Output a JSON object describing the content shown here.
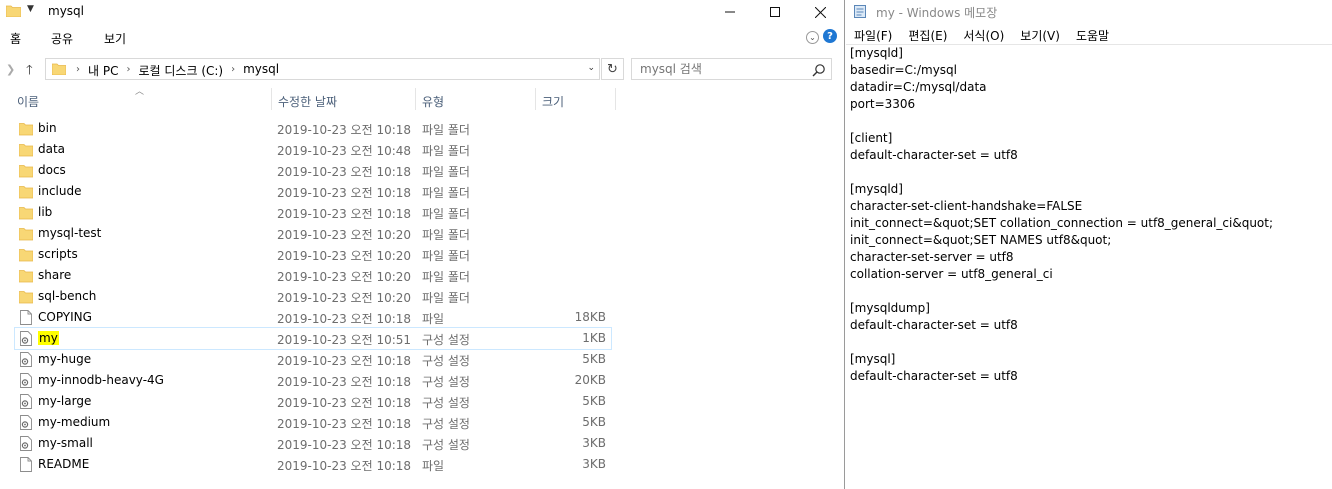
{
  "explorer": {
    "title": "mysql",
    "ribbon_tabs": [
      "홈",
      "공유",
      "보기"
    ],
    "breadcrumb": [
      "내 PC",
      "로컬 디스크 (C:)",
      "mysql"
    ],
    "search_placeholder": "mysql 검색",
    "columns": {
      "name": "이름",
      "date": "수정한 날짜",
      "type": "유형",
      "size": "크기"
    },
    "files": [
      {
        "name": "bin",
        "date": "2019-10-23 오전 10:18",
        "type": "파일 폴더",
        "size": "",
        "icon": "folder-icon"
      },
      {
        "name": "data",
        "date": "2019-10-23 오전 10:48",
        "type": "파일 폴더",
        "size": "",
        "icon": "folder-icon"
      },
      {
        "name": "docs",
        "date": "2019-10-23 오전 10:18",
        "type": "파일 폴더",
        "size": "",
        "icon": "folder-icon"
      },
      {
        "name": "include",
        "date": "2019-10-23 오전 10:18",
        "type": "파일 폴더",
        "size": "",
        "icon": "folder-icon"
      },
      {
        "name": "lib",
        "date": "2019-10-23 오전 10:18",
        "type": "파일 폴더",
        "size": "",
        "icon": "folder-icon"
      },
      {
        "name": "mysql-test",
        "date": "2019-10-23 오전 10:20",
        "type": "파일 폴더",
        "size": "",
        "icon": "folder-icon"
      },
      {
        "name": "scripts",
        "date": "2019-10-23 오전 10:20",
        "type": "파일 폴더",
        "size": "",
        "icon": "folder-icon"
      },
      {
        "name": "share",
        "date": "2019-10-23 오전 10:20",
        "type": "파일 폴더",
        "size": "",
        "icon": "folder-icon"
      },
      {
        "name": "sql-bench",
        "date": "2019-10-23 오전 10:20",
        "type": "파일 폴더",
        "size": "",
        "icon": "folder-icon"
      },
      {
        "name": "COPYING",
        "date": "2019-10-23 오전 10:18",
        "type": "파일",
        "size": "18KB",
        "icon": "file-icon"
      },
      {
        "name": "my",
        "date": "2019-10-23 오전 10:51",
        "type": "구성 설정",
        "size": "1KB",
        "icon": "config-file-icon",
        "selected": true,
        "highlighted": true
      },
      {
        "name": "my-huge",
        "date": "2019-10-23 오전 10:18",
        "type": "구성 설정",
        "size": "5KB",
        "icon": "config-file-icon"
      },
      {
        "name": "my-innodb-heavy-4G",
        "date": "2019-10-23 오전 10:18",
        "type": "구성 설정",
        "size": "20KB",
        "icon": "config-file-icon"
      },
      {
        "name": "my-large",
        "date": "2019-10-23 오전 10:18",
        "type": "구성 설정",
        "size": "5KB",
        "icon": "config-file-icon"
      },
      {
        "name": "my-medium",
        "date": "2019-10-23 오전 10:18",
        "type": "구성 설정",
        "size": "5KB",
        "icon": "config-file-icon"
      },
      {
        "name": "my-small",
        "date": "2019-10-23 오전 10:18",
        "type": "구성 설정",
        "size": "3KB",
        "icon": "config-file-icon"
      },
      {
        "name": "README",
        "date": "2019-10-23 오전 10:18",
        "type": "파일",
        "size": "3KB",
        "icon": "file-icon"
      }
    ]
  },
  "notepad": {
    "title": "my - Windows 메모장",
    "menus": [
      "파일(F)",
      "편집(E)",
      "서식(O)",
      "보기(V)",
      "도움말"
    ],
    "lines": [
      "[mysqld]",
      "basedir=C:/mysql",
      "datadir=C:/mysql/data",
      "port=3306",
      "",
      "[client]",
      "default-character-set = utf8",
      "",
      "[mysqld]",
      "character-set-client-handshake=FALSE",
      "init_connect=&quot;SET collation_connection = utf8_general_ci&quot;",
      "init_connect=&quot;SET NAMES utf8&quot;",
      "character-set-server = utf8",
      "collation-server = utf8_general_ci",
      "",
      "[mysqldump]",
      "default-character-set = utf8",
      "",
      "[mysql]",
      "default-character-set = utf8"
    ]
  },
  "colors": {
    "folder": "#f8d775",
    "folder_dark": "#e8b84a",
    "selection_border": "#cce8ff",
    "highlight": "#ffff00",
    "header_text": "#4c607a"
  }
}
